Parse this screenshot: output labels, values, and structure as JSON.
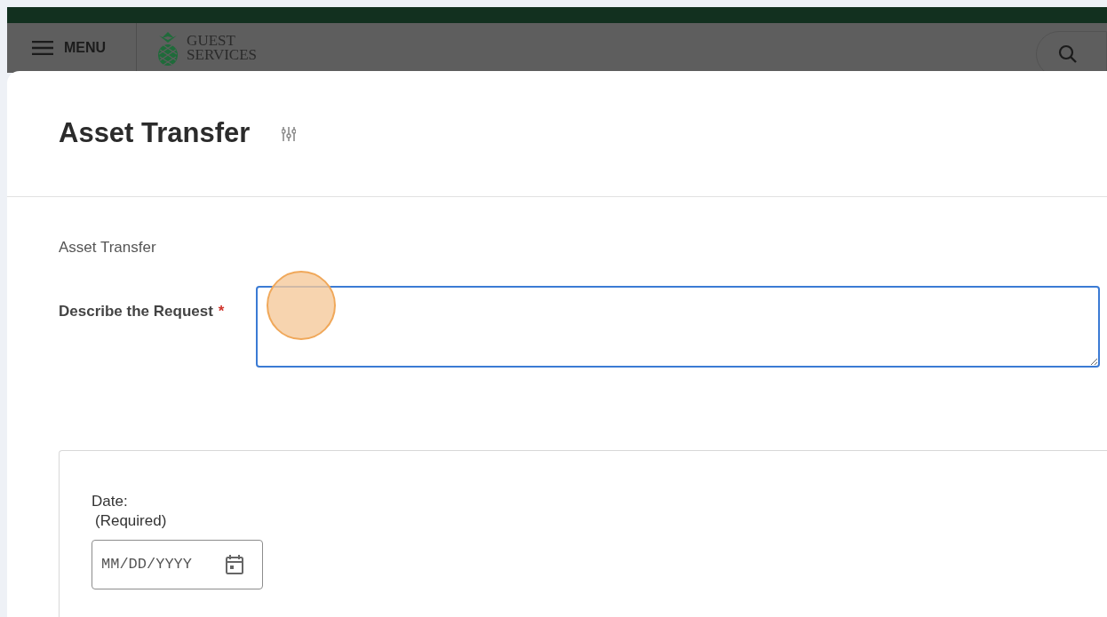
{
  "header": {
    "menu_label": "MENU",
    "logo_lines": [
      "GUEST",
      "SERVICES"
    ]
  },
  "form": {
    "title": "Asset Transfer",
    "section_label": "Asset Transfer",
    "fields": [
      {
        "label": "Describe the Request",
        "required_mark": "*"
      }
    ],
    "date_card": {
      "label": "Date:",
      "note": "(Required)",
      "placeholder": "MM/DD/YYYY"
    }
  }
}
